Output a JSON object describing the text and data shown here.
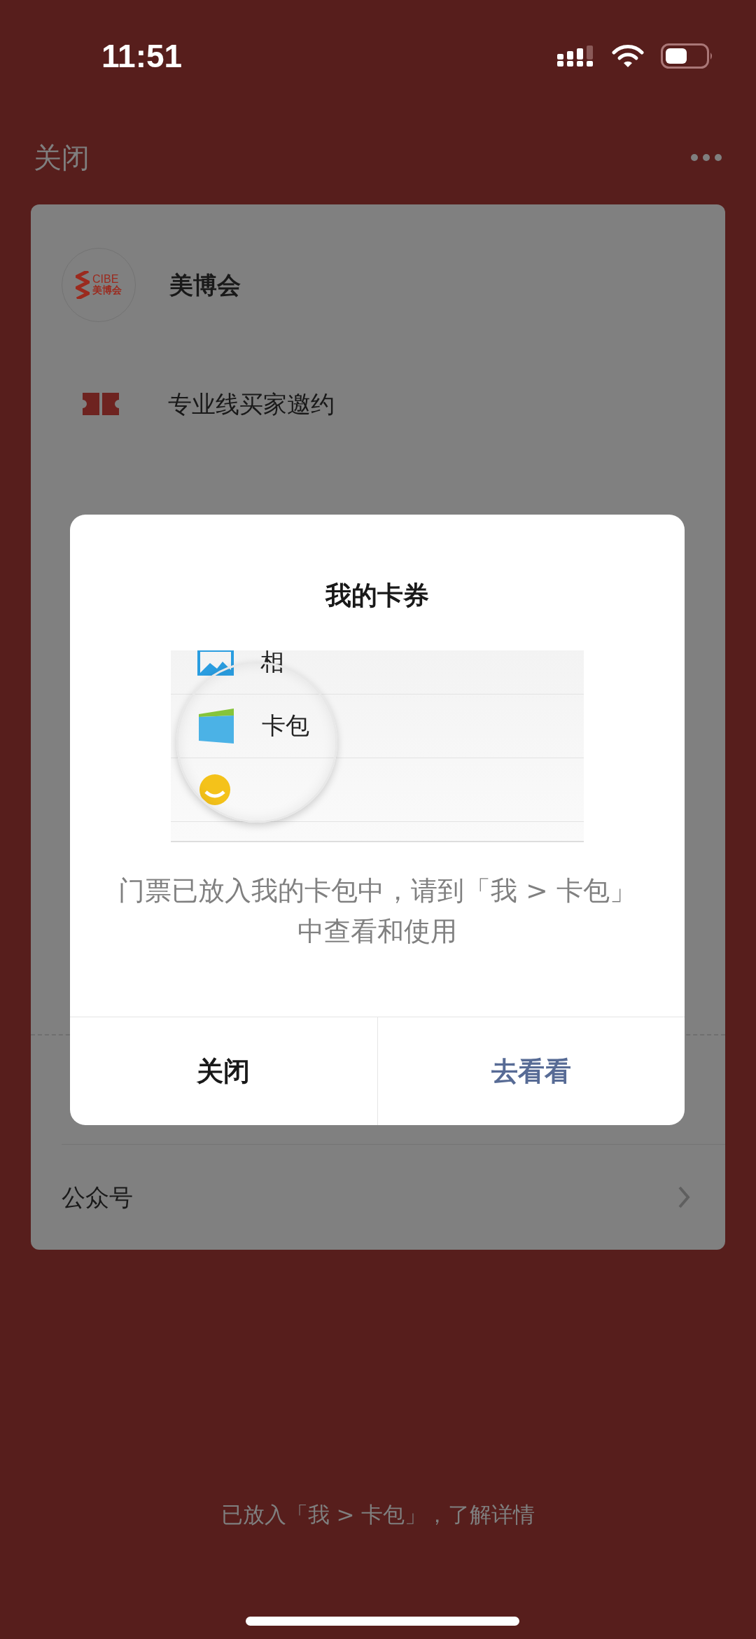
{
  "status_bar": {
    "time": "11:51"
  },
  "nav": {
    "close": "关闭"
  },
  "account": {
    "name": "美博会",
    "logo_lines": [
      "CIBE",
      "美博会"
    ]
  },
  "ticket": {
    "title": "专业线买家邀约"
  },
  "menu_rows": [
    {
      "label": "公众号"
    }
  ],
  "dialog": {
    "title": "我的卡券",
    "preview_items": [
      {
        "kind": "photos",
        "label": "相"
      },
      {
        "kind": "wallet",
        "label": "卡包"
      },
      {
        "kind": "sticker"
      }
    ],
    "message": "门票已放入我的卡包中，请到「我 > 卡包」中查看和使用",
    "buttons": [
      {
        "kind": "cancel",
        "label": "关闭"
      },
      {
        "kind": "primary",
        "label": "去看看"
      }
    ]
  },
  "footer_note": "已放入「我 > 卡包」，了解详情"
}
